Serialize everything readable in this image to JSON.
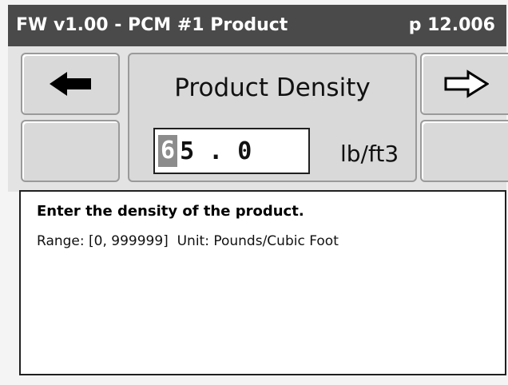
{
  "title_bar": {
    "title": "FW v1.00 - PCM #1 Product",
    "page": "p 12.006"
  },
  "nav": {
    "prev_icon": "arrow-left-filled",
    "next_icon": "arrow-right-outline"
  },
  "field": {
    "label": "Product Density",
    "cursor_digit": "6",
    "value_rest": "5 . 0",
    "unit": "lb/ft3"
  },
  "help": {
    "title": "Enter the density of the product.",
    "range": "Range: [0, 999999]  Unit: Pounds/Cubic Foot"
  },
  "colors": {
    "title_bar_bg": "#4a4a4a",
    "panel_bg": "#e3e3e3",
    "button_bg": "#d9d9d9",
    "cursor_bg": "#8c8c8c"
  }
}
